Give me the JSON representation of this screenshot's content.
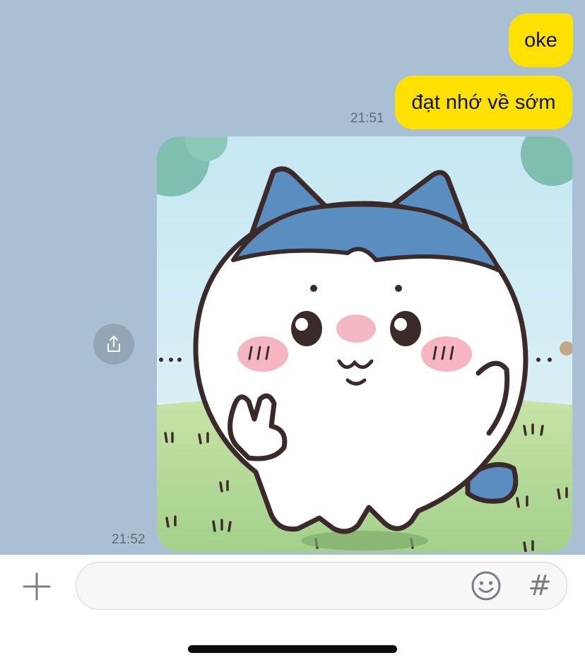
{
  "messages": [
    {
      "text": "oke",
      "sender": "me"
    },
    {
      "text": "đạt nhớ về sớm",
      "sender": "me",
      "time": "21:51"
    },
    {
      "type": "image",
      "sender": "me",
      "time": "21:52",
      "image_alt": "Chiikawa Hachiware character making a peace sign"
    }
  ],
  "input": {
    "placeholder": "",
    "value": ""
  },
  "icons": {
    "share": "share-icon",
    "plus": "plus-icon",
    "emoji": "emoji-icon",
    "hashtag": "#"
  },
  "colors": {
    "chat_background": "#a9bfd3",
    "my_bubble": "#ffe100",
    "timestamp": "#5f6d7a"
  }
}
